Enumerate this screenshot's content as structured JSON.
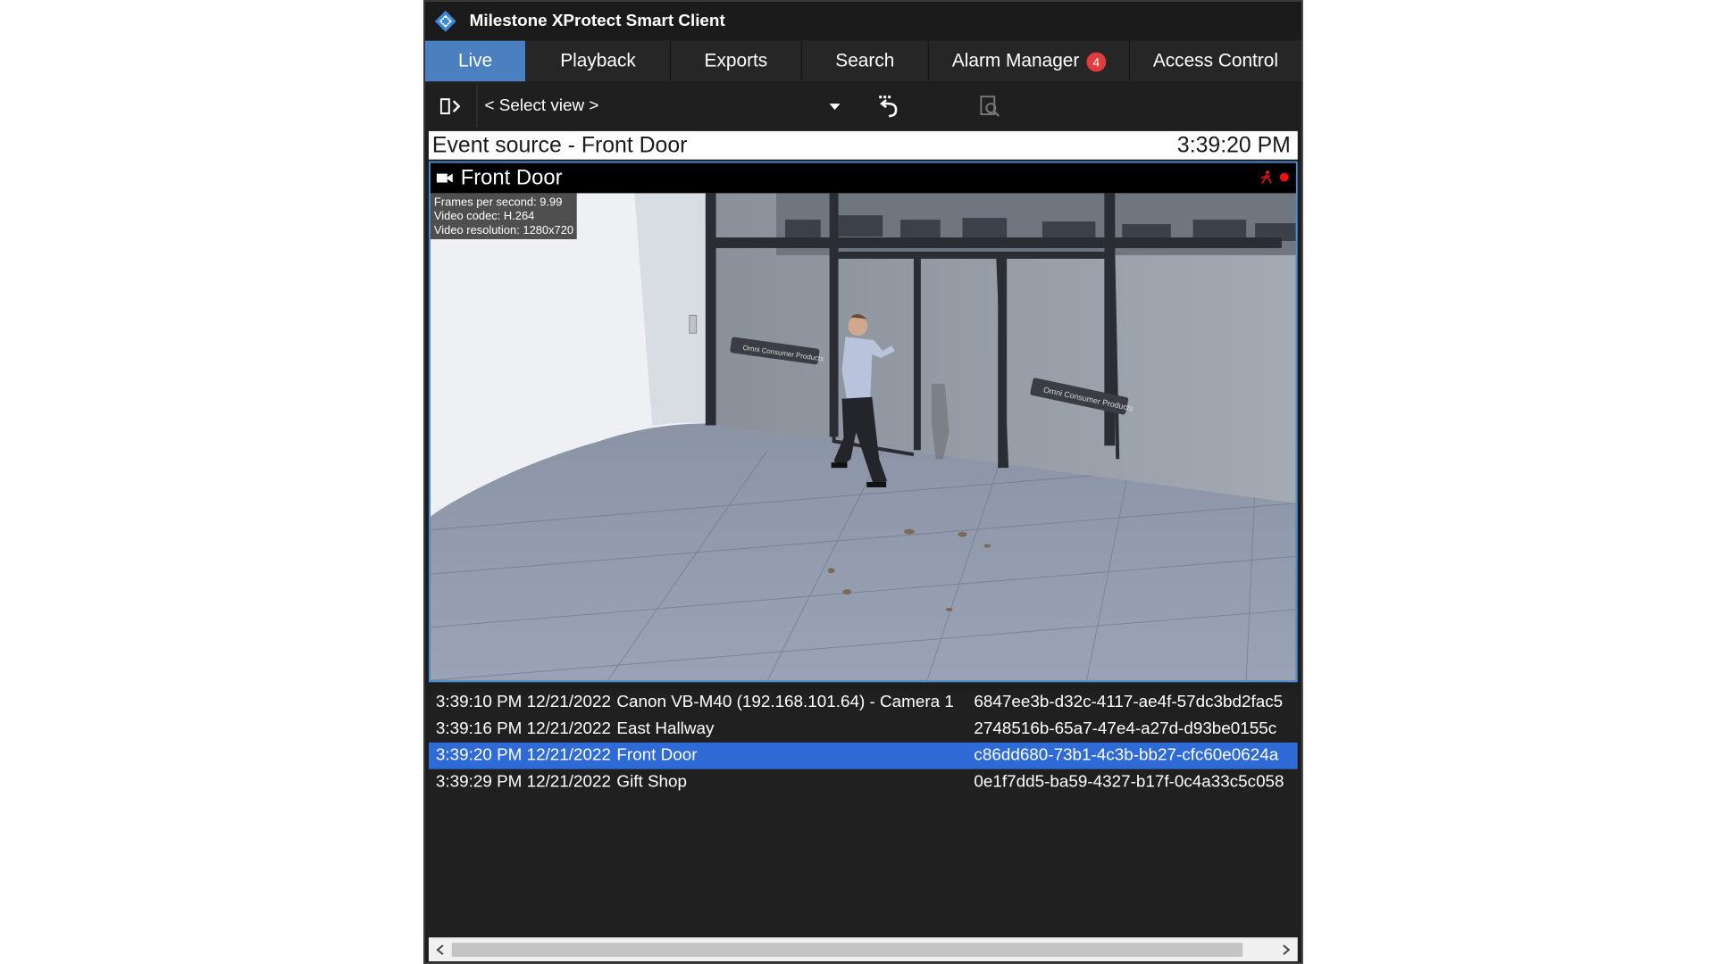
{
  "window": {
    "title": "Milestone XProtect Smart Client"
  },
  "tabs": [
    {
      "label": "Live",
      "active": true
    },
    {
      "label": "Playback"
    },
    {
      "label": "Exports"
    },
    {
      "label": "Search"
    },
    {
      "label": "Alarm Manager",
      "badge": "4"
    },
    {
      "label": "Access Control"
    }
  ],
  "toolbar": {
    "view_select": "< Select view >"
  },
  "event_header": {
    "source": "Event source - Front Door",
    "time": "3:39:20 PM"
  },
  "camera": {
    "name": "Front Door",
    "stats": {
      "fps": "Frames per second: 9.99",
      "codec": "Video codec: H.264",
      "resolution": "Video resolution: 1280x720"
    },
    "signage": "Omni Consumer Products"
  },
  "events": [
    {
      "time": "3:39:10 PM 12/21/2022",
      "source": "Canon VB-M40 (192.168.101.64) - Camera 1",
      "id": "6847ee3b-d32c-4117-ae4f-57dc3bd2fac5"
    },
    {
      "time": "3:39:16 PM 12/21/2022",
      "source": "East Hallway",
      "id": "2748516b-65a7-47e4-a27d-d93be0155c"
    },
    {
      "time": "3:39:20 PM 12/21/2022",
      "source": "Front Door",
      "id": "c86dd680-73b1-4c3b-bb27-cfc60e0624a",
      "selected": true
    },
    {
      "time": "3:39:29 PM 12/21/2022",
      "source": "Gift Shop",
      "id": "0e1f7dd5-ba59-4327-b17f-0c4a33c5c058"
    }
  ],
  "colors": {
    "accent": "#4a7fc0",
    "selected_row": "#2e6bd6",
    "badge": "#e23b3b",
    "rec": "#ee1111"
  }
}
